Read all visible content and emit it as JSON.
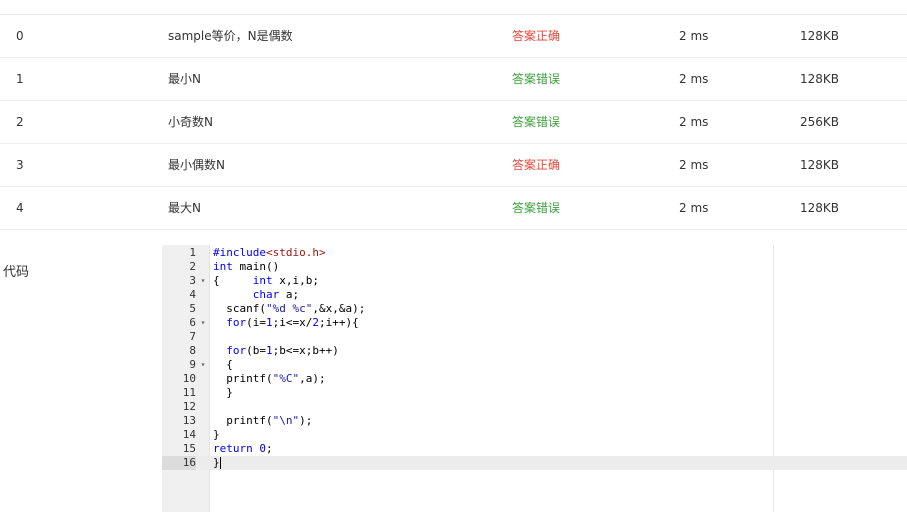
{
  "results": [
    {
      "id": "0",
      "name": "sample等价，N是偶数",
      "status": "答案正确",
      "status_type": "correct",
      "time": "2 ms",
      "memory": "128KB"
    },
    {
      "id": "1",
      "name": "最小N",
      "status": "答案错误",
      "status_type": "wrong",
      "time": "2 ms",
      "memory": "128KB"
    },
    {
      "id": "2",
      "name": "小奇数N",
      "status": "答案错误",
      "status_type": "wrong",
      "time": "2 ms",
      "memory": "256KB"
    },
    {
      "id": "3",
      "name": "最小偶数N",
      "status": "答案正确",
      "status_type": "correct",
      "time": "2 ms",
      "memory": "128KB"
    },
    {
      "id": "4",
      "name": "最大N",
      "status": "答案错误",
      "status_type": "wrong",
      "time": "2 ms",
      "memory": "128KB"
    }
  ],
  "code_label": "代码",
  "colors": {
    "correct": "#e04a3b",
    "wrong": "#3ea03e",
    "keyword": "#0000ff"
  },
  "code": {
    "active_line": 16,
    "fold_lines": [
      3,
      6,
      9
    ],
    "fold_icon": "fold-arrow-icon",
    "lines": [
      "#include<stdio.h>",
      "int main()",
      "{     int x,i,b;",
      "      char a;",
      "  scanf(\"%d %c\",&x,&a);",
      "  for(i=1;i<=x/2;i++){",
      "",
      "  for(b=1;b<=x;b++)",
      "  {",
      "  printf(\"%C\",a);",
      "  }",
      "",
      "  printf(\"\\n\");",
      "}",
      "return 0;",
      "}"
    ]
  }
}
